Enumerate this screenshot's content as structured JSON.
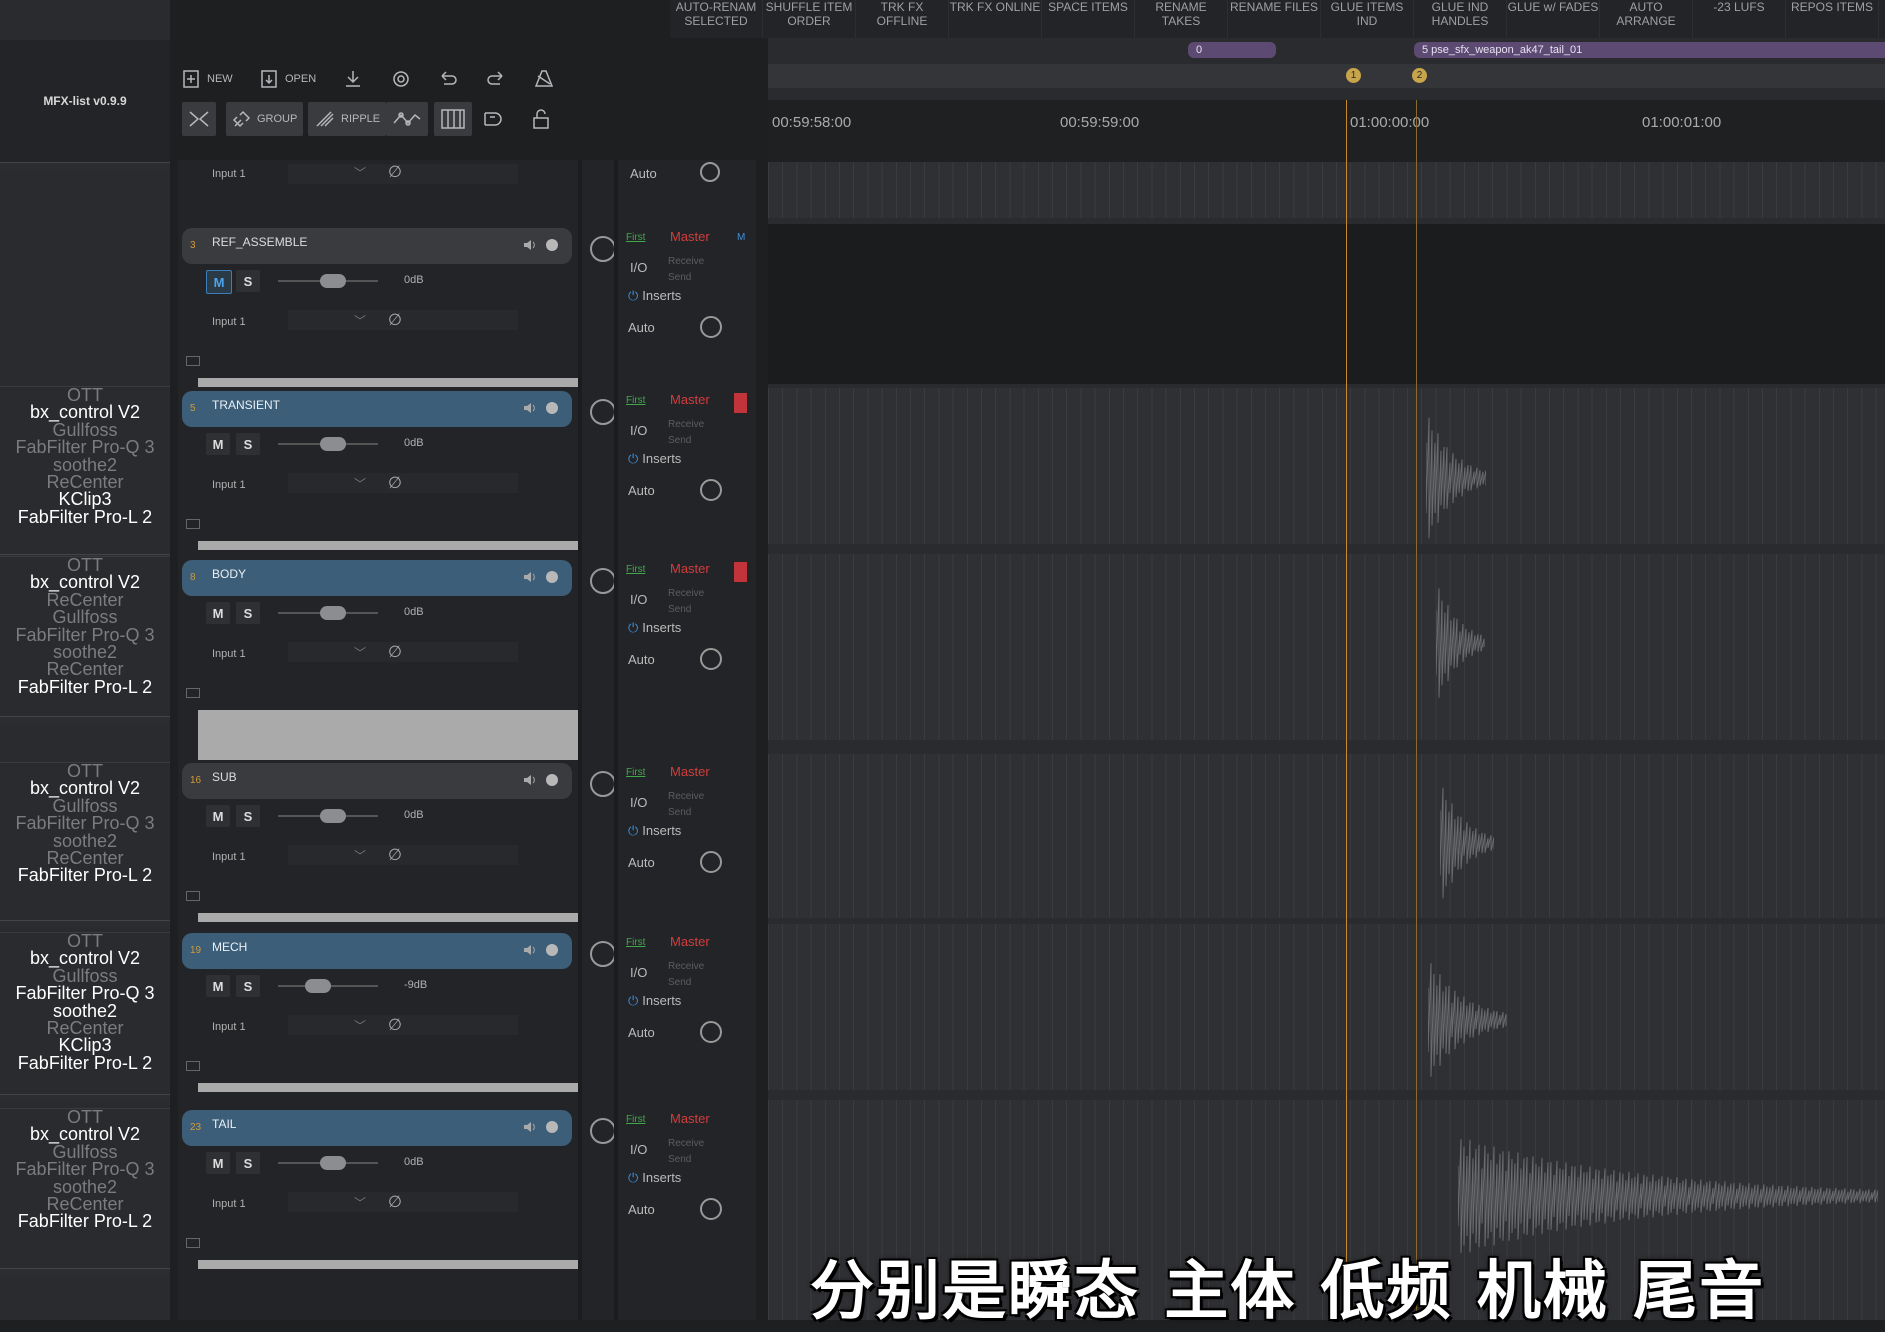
{
  "actions": [
    {
      "label": "AUTO-RENAM SELECTED"
    },
    {
      "label": "SHUFFLE ITEM ORDER"
    },
    {
      "label": "TRK FX OFFLINE"
    },
    {
      "label": "TRK FX ONLINE"
    },
    {
      "label": "SPACE ITEMS"
    },
    {
      "label": "RENAME TAKES"
    },
    {
      "label": "RENAME FILES"
    },
    {
      "label": "GLUE ITEMS IND"
    },
    {
      "label": "GLUE IND HANDLES"
    },
    {
      "label": "GLUE w/ FADES"
    },
    {
      "label": "AUTO ARRANGE"
    },
    {
      "label": "-23 LUFS"
    },
    {
      "label": "REPOS ITEMS"
    }
  ],
  "brand": "MFX-list v0.9.9",
  "toolbar": {
    "new_label": "NEW",
    "open_label": "OPEN",
    "group_label": "GROUP",
    "ripple_label": "RIPPLE"
  },
  "top_strip": {
    "input_label": "Input 1",
    "auto_label": "Auto"
  },
  "fx_lists": [
    {
      "items": [
        [
          "OTT",
          false
        ],
        [
          "bx_control V2",
          true
        ],
        [
          "Gullfoss",
          false
        ],
        [
          "FabFilter Pro-Q 3",
          false
        ],
        [
          "soothe2",
          false
        ],
        [
          "ReCenter",
          false
        ],
        [
          "KClip3",
          true
        ],
        [
          "FabFilter Pro-L 2",
          true
        ]
      ]
    },
    {
      "items": [
        [
          "OTT",
          false
        ],
        [
          "bx_control V2",
          true
        ],
        [
          "ReCenter",
          false
        ],
        [
          "Gullfoss",
          false
        ],
        [
          "FabFilter Pro-Q 3",
          false
        ],
        [
          "soothe2",
          false
        ],
        [
          "ReCenter",
          false
        ],
        [
          "FabFilter Pro-L 2",
          true
        ]
      ]
    },
    {
      "items": [
        [
          "OTT",
          false
        ],
        [
          "bx_control V2",
          true
        ],
        [
          "Gullfoss",
          false
        ],
        [
          "FabFilter Pro-Q 3",
          false
        ],
        [
          "soothe2",
          false
        ],
        [
          "ReCenter",
          false
        ],
        [
          "FabFilter Pro-L 2",
          true
        ]
      ]
    },
    {
      "items": [
        [
          "OTT",
          false
        ],
        [
          "bx_control V2",
          true
        ],
        [
          "Gullfoss",
          false
        ],
        [
          "FabFilter Pro-Q 3",
          true
        ],
        [
          "soothe2",
          true
        ],
        [
          "ReCenter",
          false
        ],
        [
          "KClip3",
          true
        ],
        [
          "FabFilter Pro-L 2",
          true
        ]
      ]
    },
    {
      "items": [
        [
          "OTT",
          false
        ],
        [
          "bx_control V2",
          true
        ],
        [
          "Gullfoss",
          false
        ],
        [
          "FabFilter Pro-Q 3",
          false
        ],
        [
          "soothe2",
          false
        ],
        [
          "ReCenter",
          false
        ],
        [
          "FabFilter Pro-L 2",
          true
        ]
      ]
    }
  ],
  "tracks": [
    {
      "num": "3",
      "name": "REF_ASSEMBLE",
      "gain": "0dB",
      "input": "Input 1",
      "mute_active": true,
      "blue": false,
      "flag": false,
      "level": 0.35
    },
    {
      "num": "5",
      "name": "TRANSIENT",
      "gain": "0dB",
      "input": "Input 1",
      "mute_active": false,
      "blue": true,
      "flag": true,
      "level": 0.35
    },
    {
      "num": "8",
      "name": "BODY",
      "gain": "0dB",
      "input": "Input 1",
      "mute_active": false,
      "blue": true,
      "flag": true,
      "level": 0.35
    },
    {
      "num": "16",
      "name": "SUB",
      "gain": "0dB",
      "input": "Input 1",
      "mute_active": false,
      "blue": false,
      "flag": false,
      "level": 0.35
    },
    {
      "num": "19",
      "name": "MECH",
      "gain": "-9dB",
      "input": "Input 1",
      "mute_active": false,
      "blue": true,
      "flag": false,
      "level": 0.2
    },
    {
      "num": "23",
      "name": "TAIL",
      "gain": "0dB",
      "input": "Input 1",
      "mute_active": false,
      "blue": true,
      "flag": false,
      "level": 0.35
    }
  ],
  "routing": {
    "first": "First",
    "master": "Master",
    "io": "I/O",
    "receive": "Receive",
    "send": "Send",
    "inserts": "Inserts",
    "auto": "Auto",
    "m_flag": "M"
  },
  "timeline": {
    "timecodes": [
      "00:59:58:00",
      "00:59:59:00",
      "01:00:00:00",
      "01:00:01:00"
    ],
    "region_0": "0",
    "region_5": "5  pse_sfx_weapon_ak47_tail_01",
    "markers": [
      "1",
      "2"
    ]
  },
  "subtitle": "分别是瞬态 主体 低频 机械 尾音",
  "colors": {
    "accent_blue": "#3d5e78",
    "master_red": "#d23d3d",
    "first_green": "#3fa84b",
    "marker_gold": "#c8a54b"
  }
}
